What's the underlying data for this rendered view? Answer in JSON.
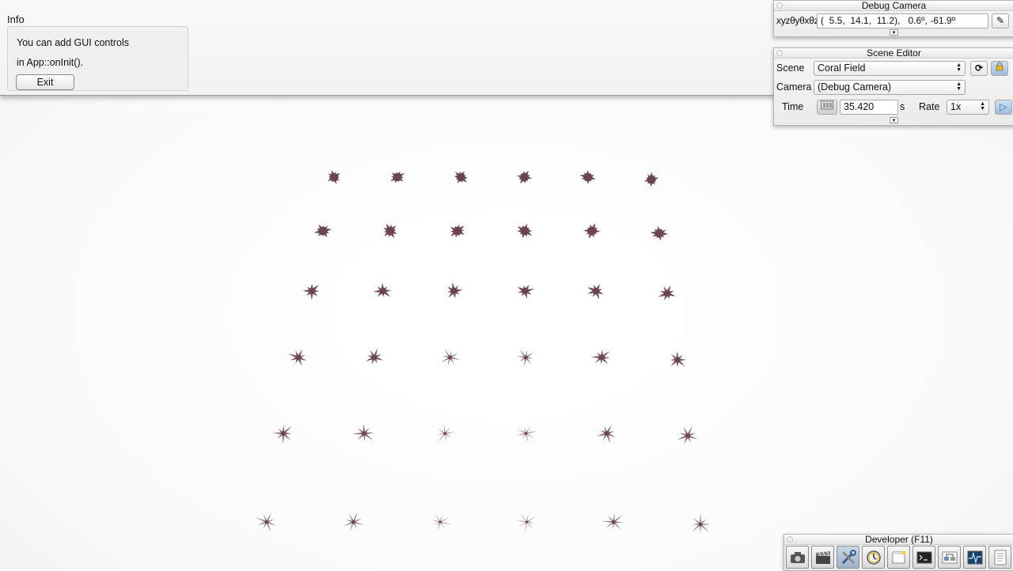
{
  "info": {
    "title": "Info",
    "line1": "You can add GUI controls",
    "line2": "in App::onInit().",
    "exit_label": "Exit"
  },
  "debug_camera": {
    "title": "Debug Camera",
    "xyz_label": "xyzθyθxθz",
    "coordinates": "(  5.5,  14.1,  11.2),   0.6º, -61.9º",
    "edit_icon": "pencil-icon",
    "expand_icon": "triangle-down-icon"
  },
  "scene_editor": {
    "title": "Scene Editor",
    "scene_label": "Scene",
    "scene_value": "Coral Field",
    "camera_label": "Camera",
    "camera_value": "(Debug Camera)",
    "time_label": "Time",
    "time_value": "35.420",
    "time_unit": "s",
    "rate_label": "Rate",
    "rate_value": "1x",
    "reload_icon": "reload-icon",
    "lock_icon": "lock-icon",
    "film_icon": "film-icon",
    "play_icon": "play-icon"
  },
  "developer": {
    "title": "Developer (F11)",
    "tools": [
      {
        "icon": "camera-icon"
      },
      {
        "icon": "clapperboard-icon"
      },
      {
        "icon": "tools-icon"
      },
      {
        "icon": "clock-icon"
      },
      {
        "icon": "window-icon"
      },
      {
        "icon": "terminal-icon"
      },
      {
        "icon": "scene-graph-icon"
      },
      {
        "icon": "profiler-icon"
      },
      {
        "icon": "document-icon"
      }
    ]
  },
  "scene": {
    "coral_color": "#6b4452",
    "rows": 6,
    "columns": 6
  }
}
